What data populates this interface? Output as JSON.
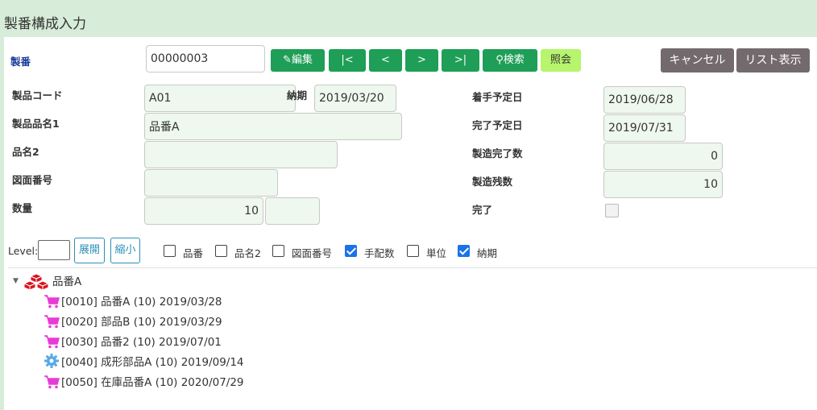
{
  "page": {
    "title": "製番構成入力"
  },
  "form": {
    "seiban_label": "製番",
    "seiban_value": "00000003",
    "product_code_label": "製品コード",
    "product_code_value": "A01",
    "due_label": "納期",
    "due_value": "2019/03/20",
    "product_name1_label": "製品品名1",
    "product_name1_value": "品番A",
    "name2_label": "品名2",
    "name2_value": "",
    "drawing_label": "図面番号",
    "drawing_value": "",
    "qty_label": "数量",
    "qty_value": "10",
    "qty_unit_value": "",
    "start_label": "着手予定日",
    "start_value": "2019/06/28",
    "finish_label": "完了予定日",
    "finish_value": "2019/07/31",
    "made_label": "製造完了数",
    "made_value": "0",
    "remain_label": "製造残数",
    "remain_value": "10",
    "done_label": "完了"
  },
  "toolbar": {
    "edit": "編集",
    "first": "|<",
    "prev": "<",
    "next": ">",
    "last": ">|",
    "search": "検索",
    "inquiry": "照会",
    "cancel": "キャンセル",
    "list": "リスト表示"
  },
  "tree_controls": {
    "level_label": "Level:",
    "level_value": "",
    "expand": "展開",
    "collapse": "縮小",
    "options": [
      {
        "label": "品番",
        "checked": false
      },
      {
        "label": "品名2",
        "checked": false
      },
      {
        "label": "図面番号",
        "checked": false
      },
      {
        "label": "手配数",
        "checked": true
      },
      {
        "label": "単位",
        "checked": false
      },
      {
        "label": "納期",
        "checked": true
      }
    ]
  },
  "tree": {
    "root": {
      "label": "品番A",
      "icon": "cubes-icon"
    },
    "children": [
      {
        "label": "[0010] 品番A (10) 2019/03/28",
        "icon": "cart-icon"
      },
      {
        "label": "[0020] 部品B (10) 2019/03/29",
        "icon": "cart-icon"
      },
      {
        "label": "[0030] 品番2 (10) 2019/07/01",
        "icon": "cart-icon"
      },
      {
        "label": "[0040] 成形部品A (10) 2019/09/14",
        "icon": "gear-icon"
      },
      {
        "label": "[0050] 在庫品番A (10) 2020/07/29",
        "icon": "cart-icon"
      }
    ]
  },
  "colors": {
    "green_button": "#1e9e56",
    "lime_button": "#b6f56c",
    "gray_button": "#736a6e",
    "header_bg": "#d7ecd9",
    "cart": "#e83bd6",
    "gear": "#5aa9e6",
    "cubes": "#d9141f"
  }
}
